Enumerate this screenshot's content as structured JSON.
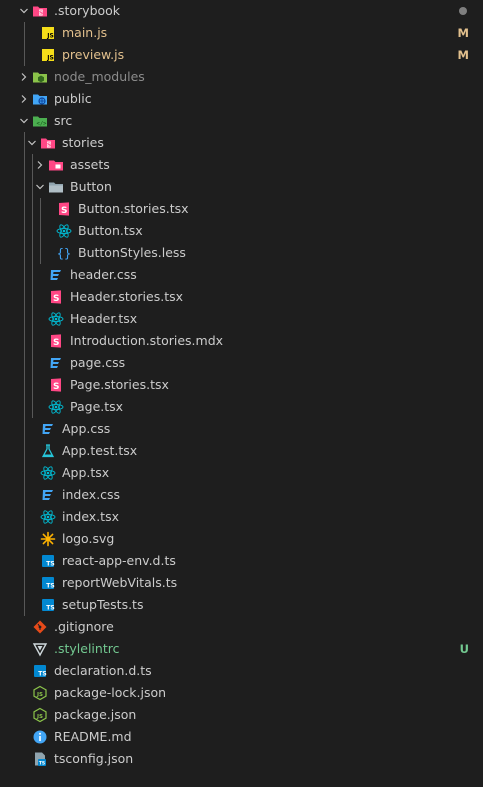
{
  "colors": {
    "default_text": "#cccccc",
    "modified": "#e2c08d",
    "untracked": "#73c991",
    "ignored": "#8c8c8c",
    "status_dot": "#7f7f7f"
  },
  "tree": [
    {
      "id": "storybook",
      "label": ".storybook",
      "type": "folder",
      "open": true,
      "depth": 0,
      "icon": "storybook-folder-icon"
    },
    {
      "id": "main-js",
      "label": "main.js",
      "type": "file",
      "depth": 1,
      "icon": "js-file-icon",
      "status": "M",
      "color": "modified"
    },
    {
      "id": "preview-js",
      "label": "preview.js",
      "type": "file",
      "depth": 1,
      "icon": "js-file-icon",
      "status": "M",
      "color": "modified"
    },
    {
      "id": "node-modules",
      "label": "node_modules",
      "type": "folder",
      "open": false,
      "depth": 0,
      "icon": "node-folder-icon",
      "color": "ignored"
    },
    {
      "id": "public",
      "label": "public",
      "type": "folder",
      "open": false,
      "depth": 0,
      "icon": "public-folder-icon"
    },
    {
      "id": "src",
      "label": "src",
      "type": "folder",
      "open": true,
      "depth": 0,
      "icon": "src-folder-icon"
    },
    {
      "id": "stories",
      "label": "stories",
      "type": "folder",
      "open": true,
      "depth": 1,
      "icon": "storybook-folder-icon"
    },
    {
      "id": "assets",
      "label": "assets",
      "type": "folder",
      "open": false,
      "depth": 2,
      "icon": "assets-folder-icon"
    },
    {
      "id": "button-folder",
      "label": "Button",
      "type": "folder",
      "open": true,
      "depth": 2,
      "icon": "folder-icon"
    },
    {
      "id": "button-stories",
      "label": "Button.stories.tsx",
      "type": "file",
      "depth": 3,
      "icon": "storybook-file-icon"
    },
    {
      "id": "button-tsx",
      "label": "Button.tsx",
      "type": "file",
      "depth": 3,
      "icon": "react-icon"
    },
    {
      "id": "button-styles",
      "label": "ButtonStyles.less",
      "type": "file",
      "depth": 3,
      "icon": "less-braces-icon"
    },
    {
      "id": "header-css",
      "label": "header.css",
      "type": "file",
      "depth": 2,
      "icon": "css-icon"
    },
    {
      "id": "header-stories",
      "label": "Header.stories.tsx",
      "type": "file",
      "depth": 2,
      "icon": "storybook-file-icon"
    },
    {
      "id": "header-tsx",
      "label": "Header.tsx",
      "type": "file",
      "depth": 2,
      "icon": "react-icon"
    },
    {
      "id": "intro-mdx",
      "label": "Introduction.stories.mdx",
      "type": "file",
      "depth": 2,
      "icon": "storybook-file-icon"
    },
    {
      "id": "page-css",
      "label": "page.css",
      "type": "file",
      "depth": 2,
      "icon": "css-icon"
    },
    {
      "id": "page-stories",
      "label": "Page.stories.tsx",
      "type": "file",
      "depth": 2,
      "icon": "storybook-file-icon"
    },
    {
      "id": "page-tsx",
      "label": "Page.tsx",
      "type": "file",
      "depth": 2,
      "icon": "react-icon"
    },
    {
      "id": "app-css",
      "label": "App.css",
      "type": "file",
      "depth": 1,
      "icon": "css-icon"
    },
    {
      "id": "app-test",
      "label": "App.test.tsx",
      "type": "file",
      "depth": 1,
      "icon": "test-flask-icon"
    },
    {
      "id": "app-tsx",
      "label": "App.tsx",
      "type": "file",
      "depth": 1,
      "icon": "react-icon"
    },
    {
      "id": "index-css",
      "label": "index.css",
      "type": "file",
      "depth": 1,
      "icon": "css-icon"
    },
    {
      "id": "index-tsx",
      "label": "index.tsx",
      "type": "file",
      "depth": 1,
      "icon": "react-icon"
    },
    {
      "id": "logo-svg",
      "label": "logo.svg",
      "type": "file",
      "depth": 1,
      "icon": "svg-sun-icon"
    },
    {
      "id": "react-app-env",
      "label": "react-app-env.d.ts",
      "type": "file",
      "depth": 1,
      "icon": "ts-file-icon"
    },
    {
      "id": "report-web-vitals",
      "label": "reportWebVitals.ts",
      "type": "file",
      "depth": 1,
      "icon": "ts-file-icon"
    },
    {
      "id": "setup-tests",
      "label": "setupTests.ts",
      "type": "file",
      "depth": 1,
      "icon": "ts-file-icon"
    },
    {
      "id": "gitignore",
      "label": ".gitignore",
      "type": "file",
      "depth": 0,
      "icon": "git-icon"
    },
    {
      "id": "stylelintrc",
      "label": ".stylelintrc",
      "type": "file",
      "depth": 0,
      "icon": "stylelint-icon",
      "status": "U",
      "color": "untracked"
    },
    {
      "id": "declaration",
      "label": "declaration.d.ts",
      "type": "file",
      "depth": 0,
      "icon": "ts-file-icon"
    },
    {
      "id": "package-lock",
      "label": "package-lock.json",
      "type": "file",
      "depth": 0,
      "icon": "npm-json-icon"
    },
    {
      "id": "package-json",
      "label": "package.json",
      "type": "file",
      "depth": 0,
      "icon": "npm-json-icon"
    },
    {
      "id": "readme",
      "label": "README.md",
      "type": "file",
      "depth": 0,
      "icon": "info-icon"
    },
    {
      "id": "tsconfig",
      "label": "tsconfig.json",
      "type": "file",
      "depth": 0,
      "icon": "tsconfig-icon"
    }
  ]
}
